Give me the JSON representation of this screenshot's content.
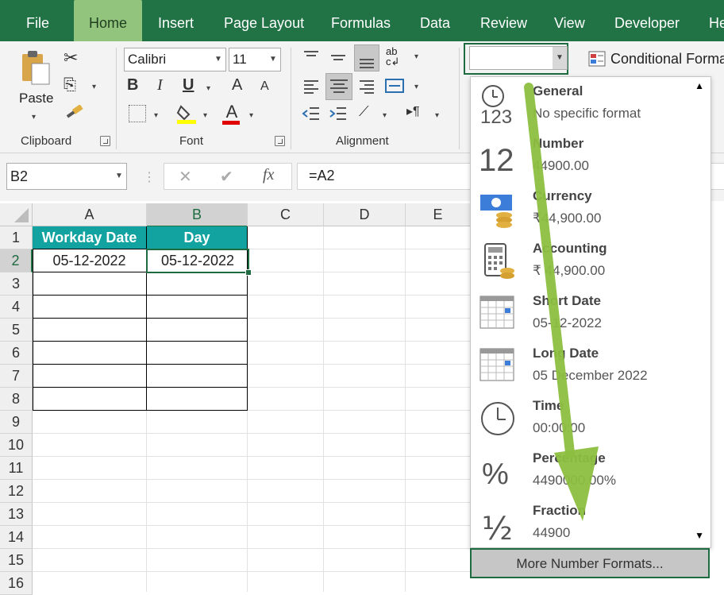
{
  "ribbon_tabs": [
    "File",
    "Home",
    "Insert",
    "Page Layout",
    "Formulas",
    "Data",
    "Review",
    "View",
    "Developer",
    "He"
  ],
  "active_tab": "Home",
  "clipboard": {
    "paste_label": "Paste",
    "group_label": "Clipboard"
  },
  "font": {
    "name": "Calibri",
    "size": "11",
    "group_label": "Font",
    "bold": "B",
    "italic": "I",
    "underline": "U",
    "grow": "A",
    "shrink": "A",
    "font_color": "A"
  },
  "alignment": {
    "group_label": "Alignment",
    "wrap": "ab c"
  },
  "number_format": {
    "current": "",
    "conditional_label": "Conditional Forma"
  },
  "formula_bar": {
    "name_box": "B2",
    "cancel": "✕",
    "enter": "✔",
    "fx": "fx",
    "formula": "=A2"
  },
  "columns": [
    "A",
    "B",
    "C",
    "D",
    "E"
  ],
  "rows": [
    "1",
    "2",
    "3",
    "4",
    "5",
    "6",
    "7",
    "8",
    "9",
    "10",
    "11",
    "12",
    "13",
    "14",
    "15",
    "16"
  ],
  "table": {
    "headers": [
      "Workday Date",
      "Day"
    ],
    "row2": [
      "05-12-2022",
      "05-12-2022"
    ]
  },
  "selected_cell": "B2",
  "formats": [
    {
      "name": "General",
      "sample": "No specific format",
      "icon": "general-icon"
    },
    {
      "name": "Number",
      "sample": "44900.00",
      "icon": "number-icon"
    },
    {
      "name": "Currency",
      "sample": "₹44,900.00",
      "icon": "currency-icon"
    },
    {
      "name": "Accounting",
      "sample": " ₹ 44,900.00",
      "icon": "accounting-icon"
    },
    {
      "name": "Short Date",
      "sample": "05-12-2022",
      "icon": "short-date-icon"
    },
    {
      "name": "Long Date",
      "sample": "05 December 2022",
      "icon": "long-date-icon"
    },
    {
      "name": "Time",
      "sample": "00:00:00",
      "icon": "time-icon"
    },
    {
      "name": "Percentage",
      "sample": "4490000.00%",
      "icon": "percentage-icon"
    },
    {
      "name": "Fraction",
      "sample": "44900",
      "icon": "fraction-icon"
    }
  ],
  "more_formats_label": "More Number Formats...",
  "colors": {
    "ribbon_green": "#217346",
    "active_tab": "#93c47d",
    "header_teal": "#12a3a1",
    "arrow_green": "#8cbf3f",
    "highlight_yellow": "#ffff00",
    "font_red": "#e00000",
    "selection_border": "#1e6b41"
  }
}
